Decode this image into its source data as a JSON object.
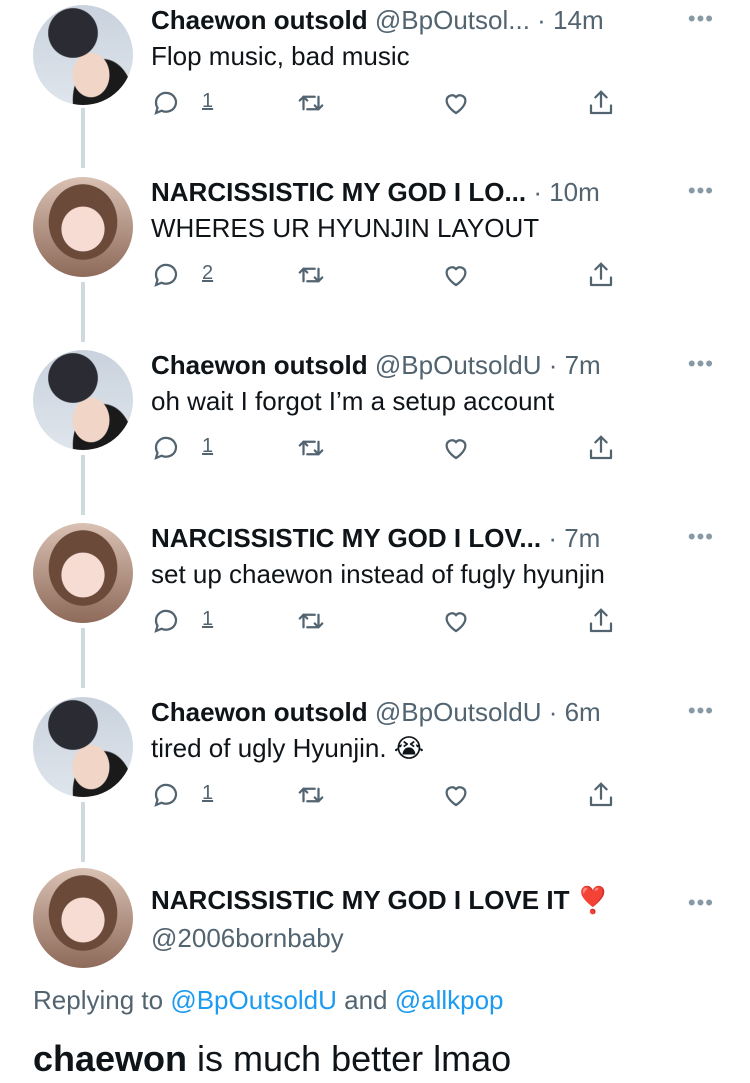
{
  "tweets": [
    {
      "name": "Chaewon outsold",
      "meta": "@BpOutsol... · 14m",
      "text": "Flop music, bad music",
      "reply_count": "1"
    },
    {
      "name": "NARCISSISTIC MY GOD I LO...",
      "meta": "· 10m",
      "text": "WHERES UR HYUNJIN LAYOUT",
      "reply_count": "2"
    },
    {
      "name": "Chaewon outsold",
      "meta": "@BpOutsoldU · 7m",
      "text": "oh wait I forgot I’m a setup account",
      "reply_count": "1"
    },
    {
      "name": "NARCISSISTIC MY GOD I LOV...",
      "meta": "· 7m",
      "text": "set up chaewon instead of fugly hyunjin",
      "reply_count": "1"
    },
    {
      "name": "Chaewon outsold",
      "meta": "@BpOutsoldU · 6m",
      "text": "tired of ugly Hyunjin. 😭",
      "reply_count": "1"
    }
  ],
  "main_tweet": {
    "name": "NARCISSISTIC MY GOD I LOVE IT ❣️",
    "handle": "@2006bornbaby",
    "replying_prefix": "Replying to ",
    "mention1": "@BpOutsoldU",
    "and_word": " and ",
    "mention2": "@allkpop",
    "text_bold": "chaewon",
    "text_rest": " is much better lmao"
  },
  "icons": {
    "reply": "reply-icon",
    "retweet": "retweet-icon",
    "like": "like-icon",
    "share": "share-icon",
    "more": "more-icon"
  },
  "colors": {
    "link": "#1d9bf0",
    "secondary_text": "#536471",
    "thread_line": "#cfd9de"
  }
}
